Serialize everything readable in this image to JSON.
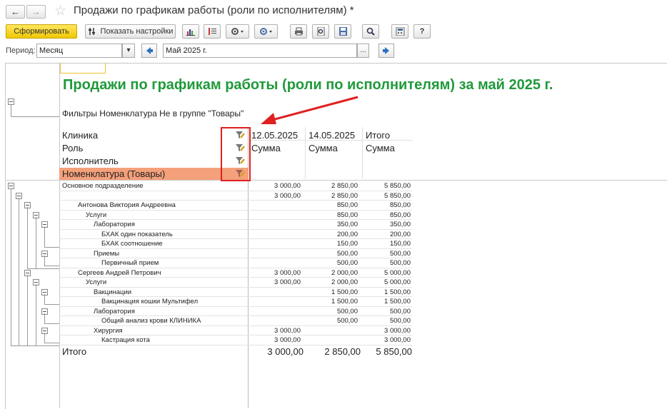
{
  "window": {
    "title": "Продажи по графикам работы (роли по исполнителям) *"
  },
  "nav": {
    "back": "←",
    "forward": "→"
  },
  "toolbar": {
    "generate_label": "Сформировать",
    "settings_label": "Показать настройки",
    "help_label": "?"
  },
  "period": {
    "label": "Период:",
    "type_value": "Месяц",
    "value": "Май 2025 г.",
    "select_glyph": "▾",
    "more_glyph": "..."
  },
  "report": {
    "title": "Продажи по графикам работы (роли по исполнителям) за май 2025 г.",
    "filter_text": "Фильтры Номенклатура Не в группе \"Товары\"",
    "row_headers": [
      "Клиника",
      "Роль",
      "Исполнитель",
      "Номенклатура (Товары)"
    ],
    "columns": [
      {
        "title": "12.05.2025",
        "sub": "Сумма"
      },
      {
        "title": "14.05.2025",
        "sub": "Сумма"
      },
      {
        "title": "Итого",
        "sub": "Сумма"
      }
    ],
    "rows": [
      {
        "label": "Основное подразделение",
        "level": 0,
        "v1": "3 000,00",
        "v2": "2 850,00",
        "v3": "5 850,00"
      },
      {
        "label": "",
        "level": 1,
        "v1": "3 000,00",
        "v2": "2 850,00",
        "v3": "5 850,00"
      },
      {
        "label": "Антонова Виктория Андреевна",
        "level": 2,
        "v1": "",
        "v2": "850,00",
        "v3": "850,00"
      },
      {
        "label": "Услуги",
        "level": 3,
        "v1": "",
        "v2": "850,00",
        "v3": "850,00"
      },
      {
        "label": "Лаборатория",
        "level": 4,
        "v1": "",
        "v2": "350,00",
        "v3": "350,00"
      },
      {
        "label": "БХАК один показатель",
        "level": 5,
        "v1": "",
        "v2": "200,00",
        "v3": "200,00"
      },
      {
        "label": "БХАК соотношение",
        "level": 5,
        "v1": "",
        "v2": "150,00",
        "v3": "150,00"
      },
      {
        "label": "Приемы",
        "level": 4,
        "v1": "",
        "v2": "500,00",
        "v3": "500,00"
      },
      {
        "label": "Первичный прием",
        "level": 5,
        "v1": "",
        "v2": "500,00",
        "v3": "500,00"
      },
      {
        "label": "Сергеев Андрей Петрович",
        "level": 2,
        "v1": "3 000,00",
        "v2": "2 000,00",
        "v3": "5 000,00"
      },
      {
        "label": "Услуги",
        "level": 3,
        "v1": "3 000,00",
        "v2": "2 000,00",
        "v3": "5 000,00"
      },
      {
        "label": "Вакцинации",
        "level": 4,
        "v1": "",
        "v2": "1 500,00",
        "v3": "1 500,00"
      },
      {
        "label": "Вакцинация кошки Мультифел",
        "level": 5,
        "v1": "",
        "v2": "1 500,00",
        "v3": "1 500,00"
      },
      {
        "label": "Лаборатория",
        "level": 4,
        "v1": "",
        "v2": "500,00",
        "v3": "500,00"
      },
      {
        "label": "Общий анализ крови КЛИНИКА",
        "level": 5,
        "v1": "",
        "v2": "500,00",
        "v3": "500,00"
      },
      {
        "label": "Хирургия",
        "level": 4,
        "v1": "3 000,00",
        "v2": "",
        "v3": "3 000,00"
      },
      {
        "label": "Кастрация кота",
        "level": 5,
        "v1": "3 000,00",
        "v2": "",
        "v3": "3 000,00"
      }
    ],
    "total": {
      "label": "Итого",
      "v1": "3 000,00",
      "v2": "2 850,00",
      "v3": "5 850,00"
    }
  },
  "colors": {
    "accent_title": "#1f9a3a",
    "highlight_row": "#f4a07a",
    "annotation": "#e02020",
    "button_primary": "#f5d20a"
  }
}
